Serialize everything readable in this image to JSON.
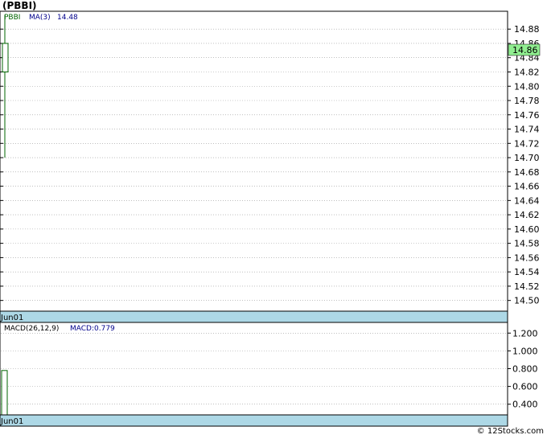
{
  "title": "(PBBI)",
  "credit": "© 12Stocks.com",
  "colors": {
    "price": "#006400",
    "ma": "#00008b",
    "axis_band": "#add8e6",
    "last_price_tag": "#90ee90",
    "grid": "#999999"
  },
  "chart_data": [
    {
      "type": "candlestick",
      "title": "",
      "legend": [
        {
          "label": "PBBI",
          "color": "#006400"
        },
        {
          "label": "MA(3)",
          "color": "#00008b"
        },
        {
          "label": "14.48",
          "color": "#00008b"
        }
      ],
      "x_tick_labels": [
        "Jun01"
      ],
      "y_ticks": [
        14.5,
        14.52,
        14.54,
        14.56,
        14.58,
        14.6,
        14.62,
        14.64,
        14.66,
        14.68,
        14.7,
        14.72,
        14.74,
        14.76,
        14.78,
        14.8,
        14.82,
        14.84,
        14.86,
        14.88
      ],
      "y_tick_labels": [
        "14.50",
        "14.52",
        "14.54",
        "14.56",
        "14.58",
        "14.60",
        "14.62",
        "14.64",
        "14.66",
        "14.68",
        "14.70",
        "14.72",
        "14.74",
        "14.76",
        "14.78",
        "14.80",
        "14.82",
        "14.84",
        "14.86",
        "14.88"
      ],
      "ylim": [
        14.485,
        14.905
      ],
      "last_price": "14.86",
      "candles": [
        {
          "x": "Jun01",
          "open": 14.82,
          "high": 14.9,
          "low": 14.7,
          "close": 14.86
        }
      ],
      "grid": true
    },
    {
      "type": "bar",
      "title": "",
      "legend": [
        {
          "label": "MACD(26,12,9)",
          "color": "#000000"
        },
        {
          "label": "MACD:0.779",
          "color": "#00008b"
        }
      ],
      "x_tick_labels": [
        "Jun01"
      ],
      "y_ticks": [
        0.4,
        0.6,
        0.8,
        1.0,
        1.2
      ],
      "y_tick_labels": [
        "0.400",
        "0.600",
        "0.800",
        "1.000",
        "1.200"
      ],
      "ylim": [
        0.28,
        1.32
      ],
      "bars": [
        {
          "x": "Jun01",
          "value": 0.779
        }
      ],
      "grid": true
    }
  ]
}
